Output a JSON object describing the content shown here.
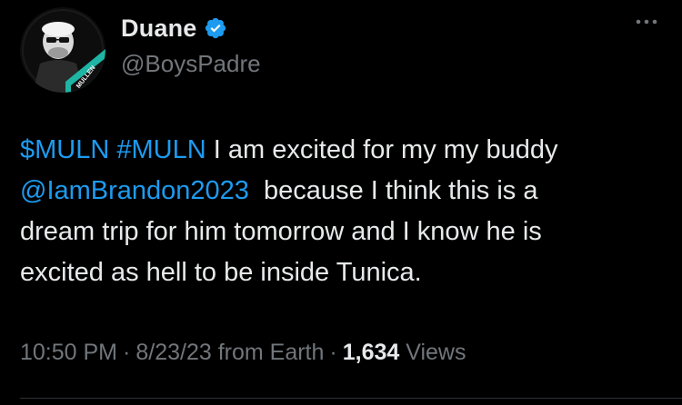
{
  "author": {
    "display_name": "Duane",
    "handle": "@BoysPadre",
    "verified": true,
    "avatar_badge_text": "MULLEN"
  },
  "tweet": {
    "cashtag": "$MULN",
    "hashtag": "#MULN",
    "text_line1": " I am excited for my my buddy",
    "mention": "@IamBrandon2023",
    "text_line2": "  because I think this is a",
    "text_line3": "dream trip for him tomorrow and I know he is",
    "text_line4": "excited as hell to be inside Tunica."
  },
  "meta": {
    "time": "10:50 PM",
    "separator": "·",
    "date": "8/23/23 from Earth",
    "views_count": "1,634",
    "views_label": " Views"
  },
  "colors": {
    "background": "#000000",
    "text": "#e7e9ea",
    "secondary": "#71767b",
    "link": "#1d9bf0",
    "verified": "#1d9bf0"
  },
  "icons": {
    "verified": "verified-badge-icon",
    "more": "more-horizontal-icon"
  }
}
